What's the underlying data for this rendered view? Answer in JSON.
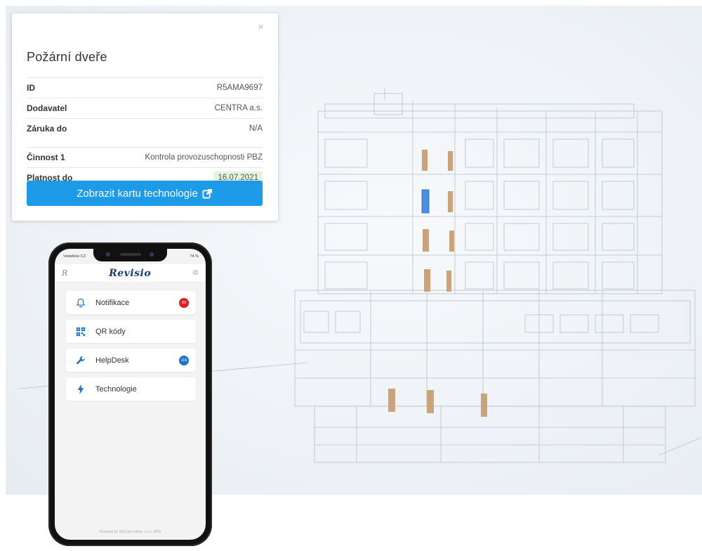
{
  "card": {
    "title": "Požární dveře",
    "close_glyph": "×",
    "rows": [
      {
        "label": "ID",
        "value": "R5AMA9697"
      },
      {
        "label": "Dodavatel",
        "value": "CENTRA a.s."
      },
      {
        "label": "Záruka do",
        "value": "N/A"
      },
      {
        "label": "Činnost 1",
        "value": "Kontrola provozuschopnosti PBZ"
      },
      {
        "label": "Platnost do",
        "value": "16.07.2021"
      }
    ],
    "button_label": "Zobrazit kartu technologie",
    "button_icon": "external-link-icon",
    "accent_color": "#1e9be8",
    "validity_badge_color": "#e2f3de"
  },
  "phone": {
    "carrier": "Vodafone CZ",
    "battery": "74 %",
    "logo_mark": "R",
    "brand": "Revisio",
    "menu": [
      {
        "label": "Notifikace",
        "icon": "bell-icon",
        "badge": "80",
        "badge_color": "#e02020"
      },
      {
        "label": "QR kódy",
        "icon": "qr-code-icon"
      },
      {
        "label": "HelpDesk",
        "icon": "wrench-icon",
        "badge": "116",
        "badge_color": "#1e73c8"
      },
      {
        "label": "Technologie",
        "icon": "lightning-icon"
      }
    ],
    "footer": "Powered by SkyCom online, s.r.o. 2020"
  },
  "viewer": {
    "highlight_door_color": "#4a90e2",
    "door_color": "#c9a37a"
  }
}
